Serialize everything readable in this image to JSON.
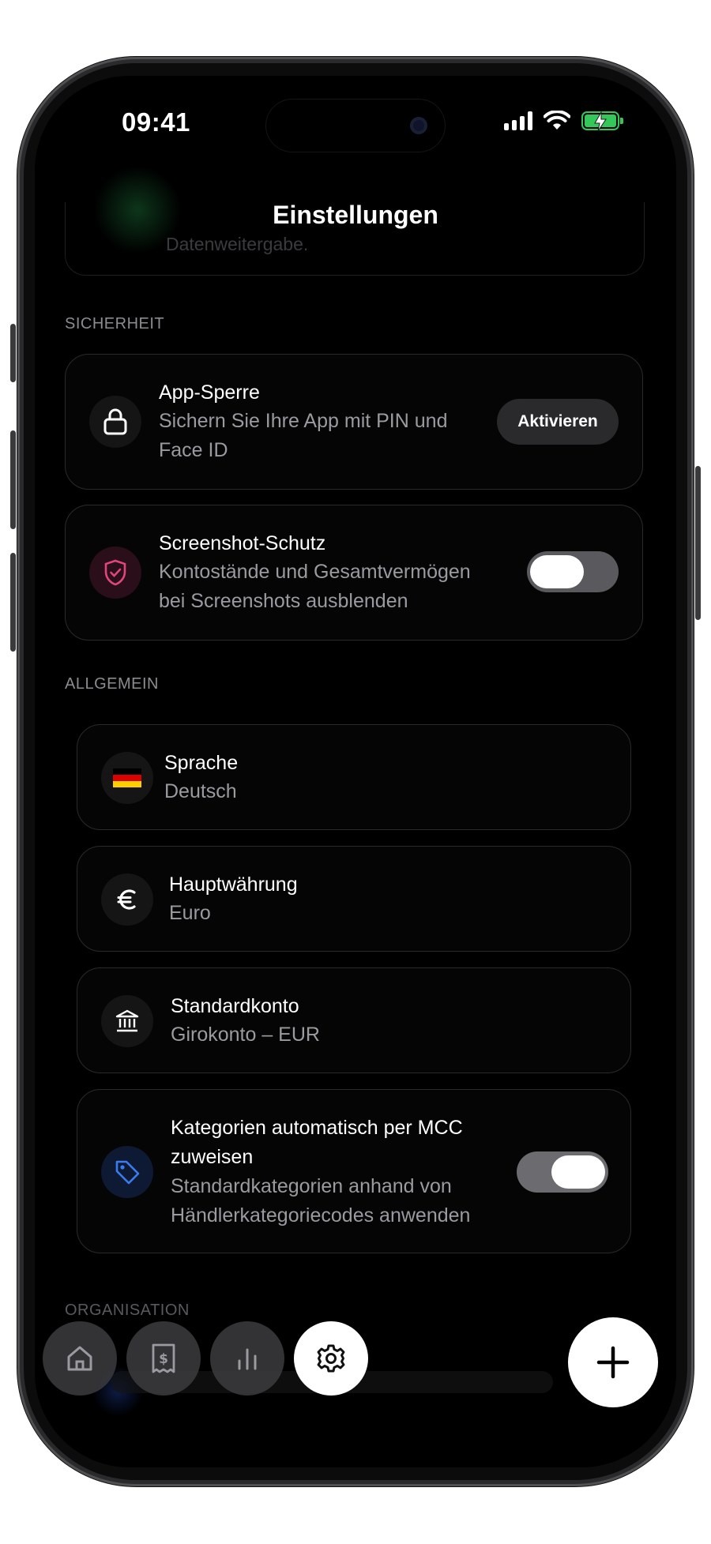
{
  "status_bar": {
    "time": "09:41"
  },
  "header": {
    "title": "Einstellungen",
    "ghost_text": "Datenweitergabe."
  },
  "sections": {
    "security": "SICHERHEIT",
    "general": "ALLGEMEIN",
    "organisation": "ORGANISATION"
  },
  "security": {
    "app_lock": {
      "title": "App-Sperre",
      "subtitle_line1": "Sichern Sie Ihre App mit PIN und",
      "subtitle_line2": "Face ID",
      "button": "Aktivieren"
    },
    "screenshot": {
      "title": "Screenshot-Schutz",
      "subtitle_line1": "Kontostände und Gesamtvermögen",
      "subtitle_line2": "bei Screenshots ausblenden",
      "enabled": false
    }
  },
  "general": {
    "language": {
      "title": "Sprache",
      "value": "Deutsch"
    },
    "currency": {
      "title": "Hauptwährung",
      "value": "Euro"
    },
    "account": {
      "title": "Standardkonto",
      "value": "Girokonto – EUR"
    },
    "mcc": {
      "title_line1": "Kategorien automatisch per MCC",
      "title_line2": "zuweisen",
      "subtitle_line1": "Standardkategorien anhand von",
      "subtitle_line2": "Händlerkategoriecodes anwenden",
      "enabled": true
    }
  },
  "tabs": [
    {
      "name": "home-icon",
      "active": false
    },
    {
      "name": "receipt-icon",
      "active": false
    },
    {
      "name": "chart-icon",
      "active": false
    },
    {
      "name": "gear-icon",
      "active": true
    }
  ],
  "colors": {
    "background": "#000000",
    "accent_pink": "#e0457b",
    "accent_blue": "#3b7bf0",
    "battery": "#34c759"
  }
}
